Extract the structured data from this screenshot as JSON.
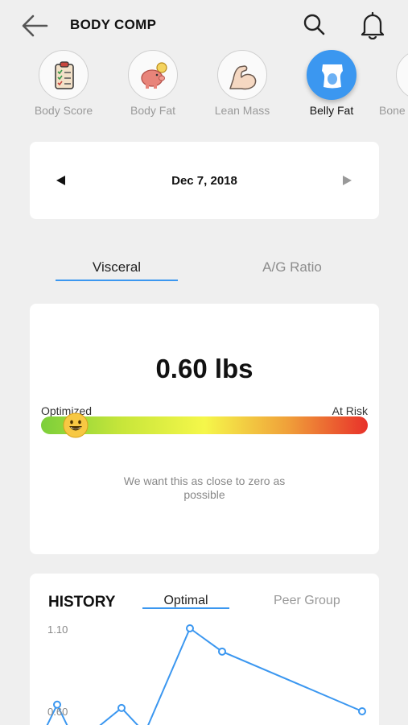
{
  "header": {
    "title": "BODY COMP"
  },
  "categories": [
    {
      "label": "Body Score",
      "icon": "clipboard-checklist-icon"
    },
    {
      "label": "Body Fat",
      "icon": "piggy-bank-icon"
    },
    {
      "label": "Lean Mass",
      "icon": "flexed-arm-icon"
    },
    {
      "label": "Belly Fat",
      "icon": "torso-icon",
      "active": true
    },
    {
      "label": "Bone",
      "icon": "bone-icon"
    }
  ],
  "date_selector": {
    "date": "Dec 7, 2018"
  },
  "metric_tabs": {
    "visceral": "Visceral",
    "ag_ratio": "A/G Ratio"
  },
  "visceral": {
    "value": "0.60 lbs",
    "scale_min_label": "Optimized",
    "scale_max_label": "At Risk",
    "indicator_fraction": 0.1,
    "hint": "We want this as close to zero as possible"
  },
  "history": {
    "title": "HISTORY",
    "tab_optimal": "Optimal",
    "tab_peer": "Peer Group"
  },
  "chart_data": {
    "type": "line",
    "y_ticks": [
      "1.10",
      "0.60"
    ],
    "series": [
      {
        "values": [
          0.38,
          0.64,
          0.4,
          0.62,
          0.47,
          1.1,
          0.96,
          0.6
        ]
      }
    ],
    "ylim": [
      0.35,
      1.1
    ],
    "color": "#3b97f0"
  },
  "colors": {
    "accent": "#3b97f0"
  }
}
